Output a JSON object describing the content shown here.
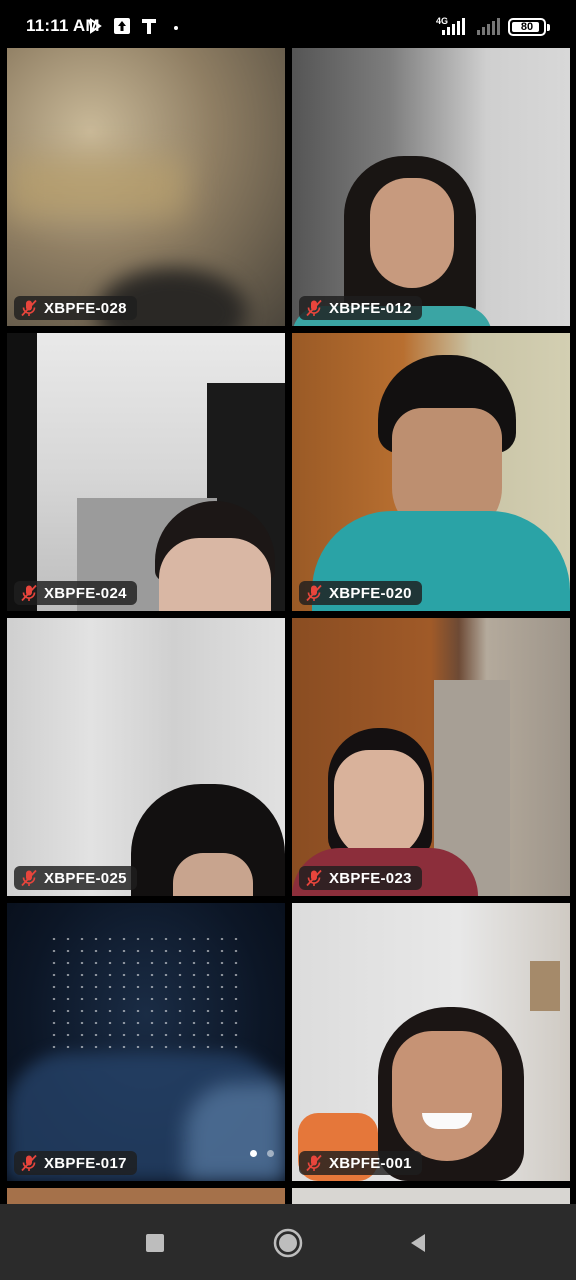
{
  "status_bar": {
    "time": "11:11 AM",
    "network": "4G",
    "battery_level": "80",
    "icons": [
      "play-icon",
      "upload-icon",
      "t-app-icon",
      "dot-icon",
      "signal-icon",
      "battery-icon"
    ]
  },
  "participants": [
    {
      "name": "XBPFE-028",
      "muted": true
    },
    {
      "name": "XBPFE-012",
      "muted": true
    },
    {
      "name": "XBPFE-024",
      "muted": true
    },
    {
      "name": "XBPFE-020",
      "muted": true
    },
    {
      "name": "XBPFE-025",
      "muted": true
    },
    {
      "name": "XBPFE-023",
      "muted": true
    },
    {
      "name": "XBPFE-017",
      "muted": true
    },
    {
      "name": "XBPFE-001",
      "muted": true
    }
  ],
  "pagination": {
    "pages": 2,
    "current": 1
  },
  "nav_bar": {
    "buttons": [
      "recents-button",
      "home-button",
      "back-button"
    ]
  },
  "colors": {
    "mic_muted": "#e8453c",
    "label_bg": "#1e1e1e",
    "nav_bg": "#2b2b2b"
  }
}
